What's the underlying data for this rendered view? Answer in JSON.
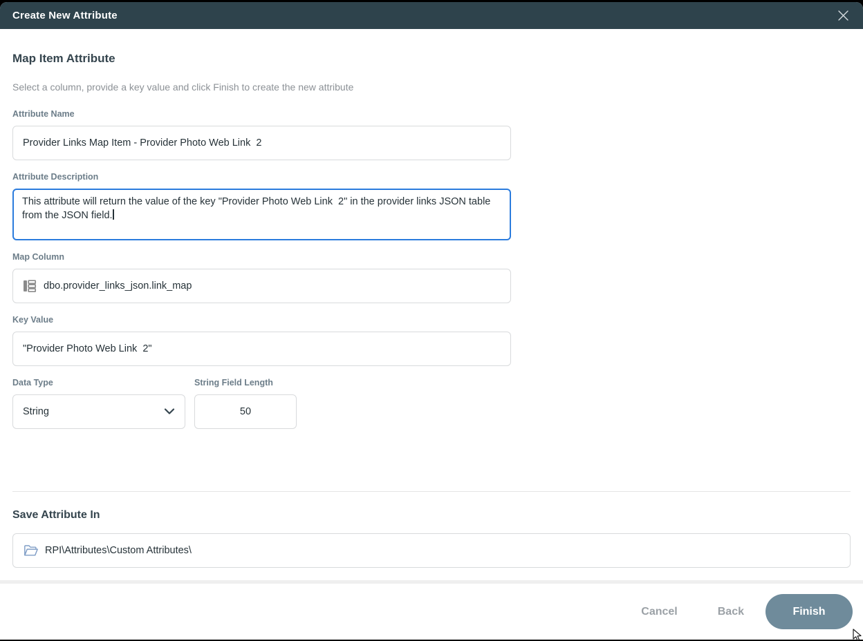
{
  "dialog": {
    "title": "Create New Attribute",
    "close_icon": "close-icon"
  },
  "wizard": {
    "heading": "Map Item Attribute",
    "subtitle": "Select a column, provide a key value and click Finish to create the new attribute",
    "fields": {
      "attribute_name": {
        "label": "Attribute Name",
        "value": "Provider Links Map Item - Provider Photo Web Link  2"
      },
      "attribute_description": {
        "label": "Attribute Description",
        "value": "This attribute will return the value of the key \"Provider Photo Web Link  2\" in the provider links JSON table from the JSON field."
      },
      "map_column": {
        "label": "Map Column",
        "value": "dbo.provider_links_json.link_map",
        "icon": "table-column-icon"
      },
      "key_value": {
        "label": "Key Value",
        "value": "\"Provider Photo Web Link  2\""
      },
      "data_type": {
        "label": "Data Type",
        "value": "String",
        "icon": "chevron-down-icon"
      },
      "string_field_length": {
        "label": "String Field Length",
        "value": "50"
      }
    },
    "save_in": {
      "heading": "Save Attribute In",
      "value": "RPI\\Attributes\\Custom Attributes\\",
      "icon": "folder-open-icon"
    }
  },
  "footer": {
    "cancel_label": "Cancel",
    "back_label": "Back",
    "finish_label": "Finish"
  },
  "colors": {
    "titlebar_bg": "#2e434c",
    "focus_border": "#2a7bdd",
    "finish_bg": "#6f8b9b",
    "heading_text": "#35454e",
    "label_text": "#6c7d89",
    "folder_icon": "#7f9dc6"
  }
}
